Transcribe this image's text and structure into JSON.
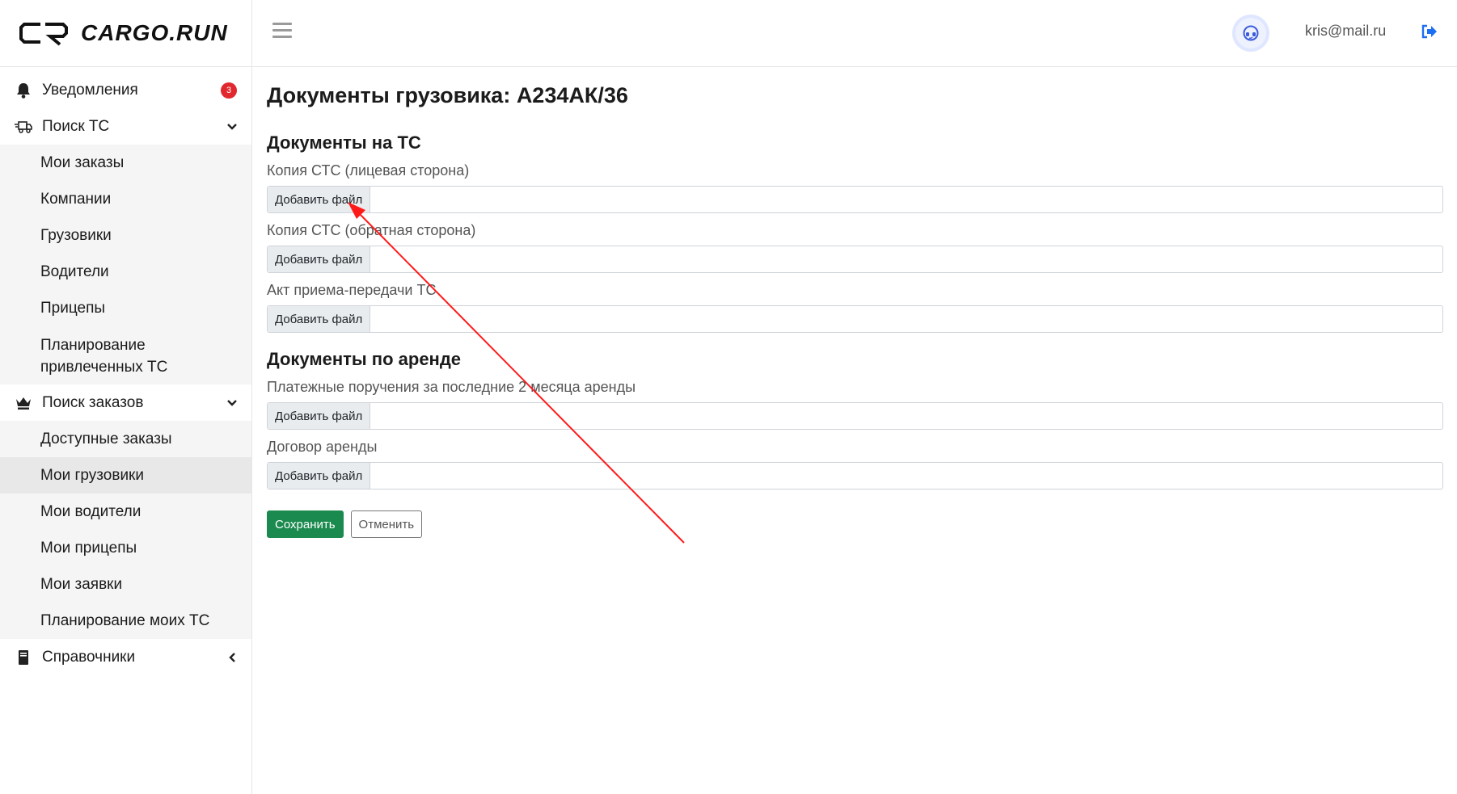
{
  "brand": {
    "name": "CARGO.RUN"
  },
  "header": {
    "user_email": "kris@mail.ru"
  },
  "sidebar": {
    "notifications": {
      "label": "Уведомления",
      "badge": "3"
    },
    "search_vehicles": {
      "label": "Поиск ТС",
      "items": [
        "Мои заказы",
        "Компании",
        "Грузовики",
        "Водители",
        "Прицепы",
        "Планирование привлеченных ТС"
      ]
    },
    "search_orders": {
      "label": "Поиск заказов",
      "items": [
        "Доступные заказы",
        "Мои грузовики",
        "Мои водители",
        "Мои прицепы",
        "Мои заявки",
        "Планирование моих ТС"
      ]
    },
    "references": {
      "label": "Справочники"
    }
  },
  "main": {
    "title": "Документы грузовика: А234АК/36",
    "section_vehicle": {
      "title": "Документы на ТС",
      "fields": [
        {
          "label": "Копия СТС (лицевая сторона)",
          "button": "Добавить файл"
        },
        {
          "label": "Копия СТС (обратная сторона)",
          "button": "Добавить файл"
        },
        {
          "label": "Акт приема-передачи ТС",
          "button": "Добавить файл"
        }
      ]
    },
    "section_rent": {
      "title": "Документы по аренде",
      "fields": [
        {
          "label": "Платежные поручения за последние 2 месяца аренды",
          "button": "Добавить файл"
        },
        {
          "label": "Договор аренды",
          "button": "Добавить файл"
        }
      ]
    },
    "save_label": "Сохранить",
    "cancel_label": "Отменить"
  },
  "colors": {
    "accent_green": "#1b8a4e",
    "badge_red": "#e0282e",
    "annotation_red": "#ff1a1a"
  }
}
